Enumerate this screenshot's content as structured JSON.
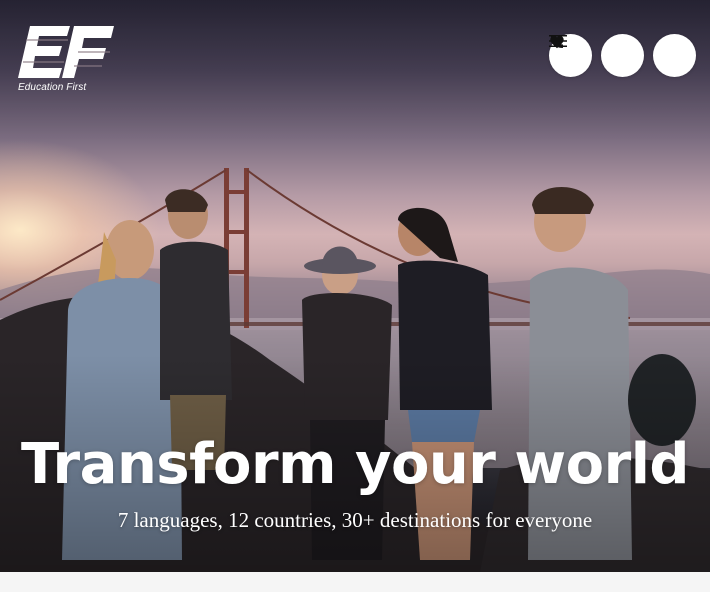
{
  "brand": {
    "logo_icon": "ef-logo",
    "tagline": "Education First"
  },
  "nav": {
    "phone_icon": "phone-icon",
    "favorites_icon": "heart-icon",
    "menu_icon": "hamburger-menu-icon"
  },
  "hero": {
    "title": "Transform your world",
    "subtitle": "7 languages, 12 countries, 30+ destinations for everyone",
    "image": "group-of-students-overlooking-golden-gate-bridge-at-sunset"
  },
  "colors": {
    "button_bg": "#ffffff",
    "icon": "#111111",
    "text_on_hero": "#ffffff",
    "page_bg": "#f5f5f5"
  }
}
